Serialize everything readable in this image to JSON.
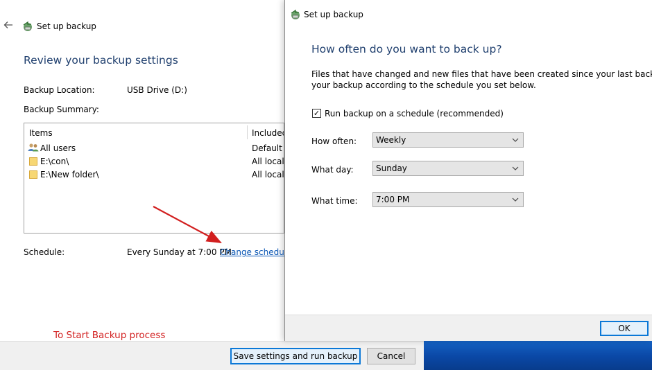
{
  "background": {
    "title": "Set up backup",
    "heading": "Review your backup settings",
    "backup_location": {
      "label": "Backup Location:",
      "value": "USB Drive (D:)"
    },
    "backup_summary_label": "Backup Summary:",
    "table": {
      "columns": [
        "Items",
        "Included"
      ],
      "rows": [
        {
          "icon": "users-icon",
          "item": "All users",
          "included": "Default W"
        },
        {
          "icon": "folder-icon",
          "item": "E:\\con\\",
          "included": "All local"
        },
        {
          "icon": "folder-icon",
          "item": "E:\\New folder\\",
          "included": "All local"
        }
      ]
    },
    "schedule": {
      "label": "Schedule:",
      "value": "Every Sunday at 7:00 PM",
      "link": "Change schedule"
    },
    "buttons": {
      "save_run": "Save settings and run backup",
      "cancel": "Cancel"
    }
  },
  "annotation": {
    "text": "To Start Backup process",
    "color": "#d21f1f"
  },
  "dialog": {
    "title": "Set up backup",
    "heading": "How often do you want to back up?",
    "description_line1": "Files that have changed and new files that have been created since your last backup will be ad",
    "description_line2": "your backup according to the schedule you set below.",
    "checkbox": {
      "label": "Run backup on a schedule (recommended)",
      "checked": true
    },
    "how_often": {
      "label": "How often:",
      "value": "Weekly"
    },
    "what_day": {
      "label": "What day:",
      "value": "Sunday"
    },
    "what_time": {
      "label": "What time:",
      "value": "7:00 PM"
    },
    "ok_button": "OK"
  },
  "colors": {
    "heading": "#1f3f6e",
    "link": "#0b57b5",
    "accent": "#0b78d7",
    "taskbar": "#0a47a5"
  }
}
